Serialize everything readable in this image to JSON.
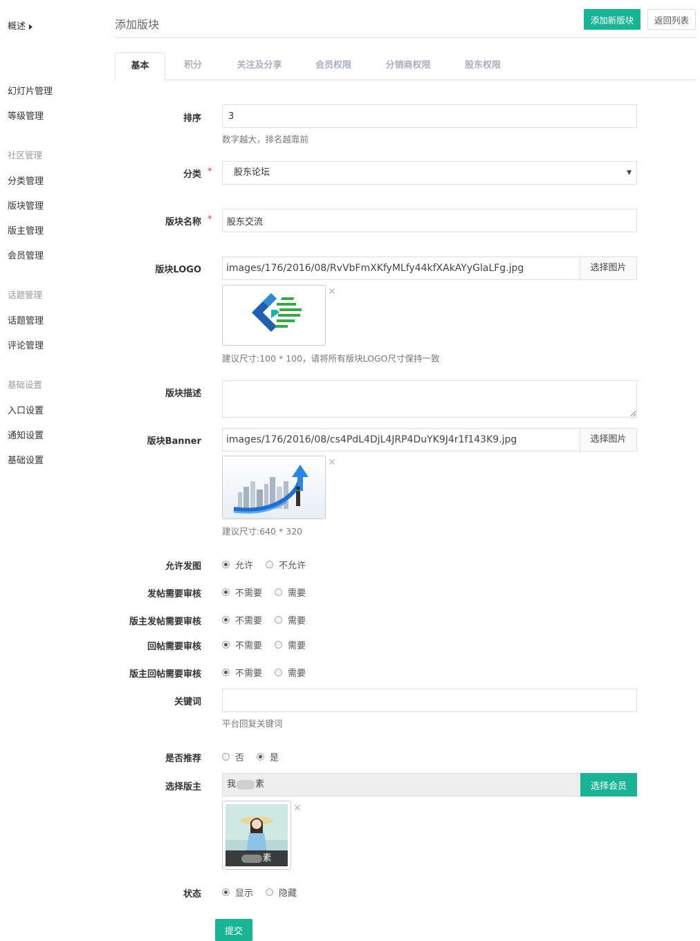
{
  "sidebar": {
    "overview": "概述",
    "items": [
      {
        "label": "幻灯片管理",
        "type": "item"
      },
      {
        "label": "等级管理",
        "type": "item"
      },
      {
        "label": "社区管理",
        "type": "group"
      },
      {
        "label": "分类管理",
        "type": "item"
      },
      {
        "label": "版块管理",
        "type": "item"
      },
      {
        "label": "版主管理",
        "type": "item"
      },
      {
        "label": "会员管理",
        "type": "item"
      },
      {
        "label": "话题管理",
        "type": "group"
      },
      {
        "label": "话题管理",
        "type": "item"
      },
      {
        "label": "评论管理",
        "type": "item"
      },
      {
        "label": "基础设置",
        "type": "group"
      },
      {
        "label": "入口设置",
        "type": "item"
      },
      {
        "label": "通知设置",
        "type": "item"
      },
      {
        "label": "基础设置",
        "type": "item"
      }
    ]
  },
  "header": {
    "title": "添加版块",
    "add_button": "添加新版块",
    "back_button": "返回列表"
  },
  "tabs": [
    "基本",
    "积分",
    "关注及分享",
    "会员权限",
    "分销商权限",
    "股东权限"
  ],
  "form": {
    "sort": {
      "label": "排序",
      "value": "3",
      "help": "数字越大，排名越靠前"
    },
    "category": {
      "label": "分类",
      "value": "股东论坛"
    },
    "name": {
      "label": "版块名称",
      "value": "股东交流"
    },
    "logo": {
      "label": "版块LOGO",
      "value": "images/176/2016/08/RvVbFmXKfyMLfy44kfXAkAYyGlaLFg.jpg",
      "button": "选择图片",
      "help": "建议尺寸:100 * 100，请将所有版块LOGO尺寸保持一致"
    },
    "description": {
      "label": "版块描述",
      "value": ""
    },
    "banner": {
      "label": "版块Banner",
      "value": "images/176/2016/08/cs4PdL4DjL4JRP4DuYK9J4r1f143K9.jpg",
      "button": "选择图片",
      "help": "建议尺寸:640 * 320"
    },
    "allow_post": {
      "label": "允许发图",
      "options": [
        "允许",
        "不允许"
      ],
      "selected": 0
    },
    "post_review": {
      "label": "发帖需要审核",
      "options": [
        "不需要",
        "需要"
      ],
      "selected": 0
    },
    "mod_post_review": {
      "label": "版主发帖需要审核",
      "options": [
        "不需要",
        "需要"
      ],
      "selected": 0
    },
    "reply_review": {
      "label": "回帖需要审核",
      "options": [
        "不需要",
        "需要"
      ],
      "selected": 0
    },
    "mod_reply_review": {
      "label": "版主回帖需要审核",
      "options": [
        "不需要",
        "需要"
      ],
      "selected": 0
    },
    "keywords": {
      "label": "关键词",
      "value": "",
      "help": "平台回复关键词"
    },
    "recommend": {
      "label": "是否推荐",
      "options": [
        "否",
        "是"
      ],
      "selected": 1
    },
    "moderator": {
      "label": "选择版主",
      "value_start": "我",
      "value_end": "素",
      "button": "选择会员",
      "caption_end": "素"
    },
    "status": {
      "label": "状态",
      "options": [
        "显示",
        "隐藏"
      ],
      "selected": 0
    },
    "submit": "提交"
  },
  "colors": {
    "accent": "#1ab394",
    "required": "#e33333"
  },
  "icons": {
    "remove": "close-icon",
    "select_arrow": "chevron-down-icon"
  }
}
